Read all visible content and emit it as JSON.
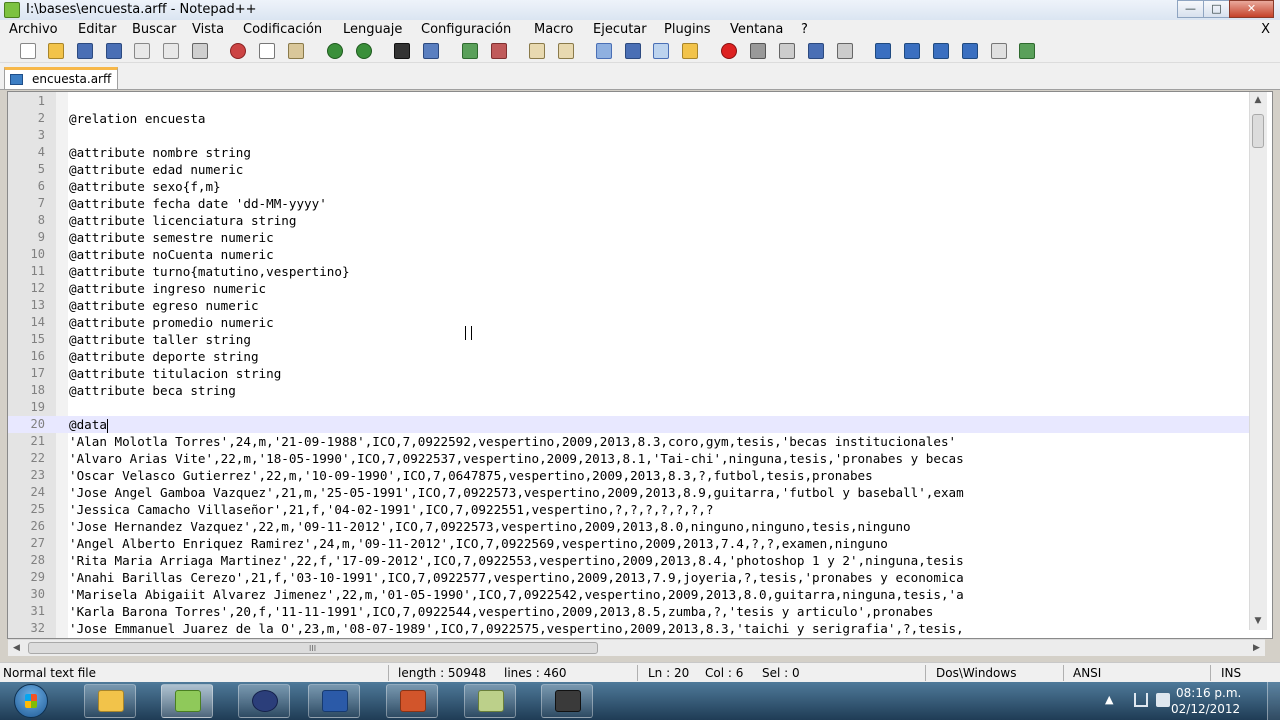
{
  "window": {
    "title": "I:\\bases\\encuesta.arff - Notepad++",
    "min": "—",
    "max": "□",
    "close": "✕"
  },
  "menu": {
    "items": [
      "Archivo",
      "Editar",
      "Buscar",
      "Vista",
      "Codificación",
      "Lenguaje",
      "Configuración",
      "Macro",
      "Ejecutar",
      "Plugins",
      "Ventana",
      "?"
    ],
    "close": "X"
  },
  "tab": {
    "label": "encuesta.arff"
  },
  "editor": {
    "lines": [
      "",
      "@relation encuesta",
      "",
      "@attribute nombre string",
      "@attribute edad numeric",
      "@attribute sexo{f,m}",
      "@attribute fecha date 'dd-MM-yyyy'",
      "@attribute licenciatura string",
      "@attribute semestre numeric",
      "@attribute noCuenta numeric",
      "@attribute turno{matutino,vespertino}",
      "@attribute ingreso numeric",
      "@attribute egreso numeric",
      "@attribute promedio numeric",
      "@attribute taller string",
      "@attribute deporte string",
      "@attribute titulacion string",
      "@attribute beca string",
      "",
      "@data",
      "'Alan Molotla Torres',24,m,'21-09-1988',ICO,7,0922592,vespertino,2009,2013,8.3,coro,gym,tesis,'becas institucionales'",
      "'Alvaro Arias Vite',22,m,'18-05-1990',ICO,7,0922537,vespertino,2009,2013,8.1,'Tai-chi',ninguna,tesis,'pronabes y becas",
      "'Oscar Velasco Gutierrez',22,m,'10-09-1990',ICO,7,0647875,vespertino,2009,2013,8.3,?,futbol,tesis,pronabes",
      "'Jose Angel Gamboa Vazquez',21,m,'25-05-1991',ICO,7,0922573,vespertino,2009,2013,8.9,guitarra,'futbol y baseball',exam",
      "'Jessica Camacho Villaseñor',21,f,'04-02-1991',ICO,7,0922551,vespertino,?,?,?,?,?,?,?",
      "'Jose Hernandez Vazquez',22,m,'09-11-2012',ICO,7,0922573,vespertino,2009,2013,8.0,ninguno,ninguno,tesis,ninguno",
      "'Angel Alberto Enriquez Ramirez',24,m,'09-11-2012',ICO,7,0922569,vespertino,2009,2013,7.4,?,?,examen,ninguno",
      "'Rita Maria Arriaga Martinez',22,f,'17-09-2012',ICO,7,0922553,vespertino,2009,2013,8.4,'photoshop 1 y 2',ninguna,tesis",
      "'Anahi Barillas Cerezo',21,f,'03-10-1991',ICO,7,0922577,vespertino,2009,2013,7.9,joyeria,?,tesis,'pronabes y economica",
      "'Marisela Abigaiit Alvarez Jimenez',22,m,'01-05-1990',ICO,7,0922542,vespertino,2009,2013,8.0,guitarra,ninguna,tesis,'a",
      "'Karla Barona Torres',20,f,'11-11-1991',ICO,7,0922544,vespertino,2009,2013,8.5,zumba,?,'tesis y articulo',pronabes",
      "'Jose Emmanuel Juarez de la O',23,m,'08-07-1989',ICO,7,0922575,vespertino,2009,2013,8.3,'taichi y serigrafia',?,tesis,"
    ],
    "current_line": 20
  },
  "hscroll_grip": "III",
  "status": {
    "file_type": "Normal text file",
    "length": "length : 50948",
    "lines": "lines : 460",
    "ln": "Ln : 20",
    "col": "Col : 6",
    "sel": "Sel : 0",
    "eol": "Dos\\Windows",
    "encoding": "ANSI",
    "mode": "INS"
  },
  "taskbar": {
    "clock_time": "08:16 p.m.",
    "clock_date": "02/12/2012"
  }
}
